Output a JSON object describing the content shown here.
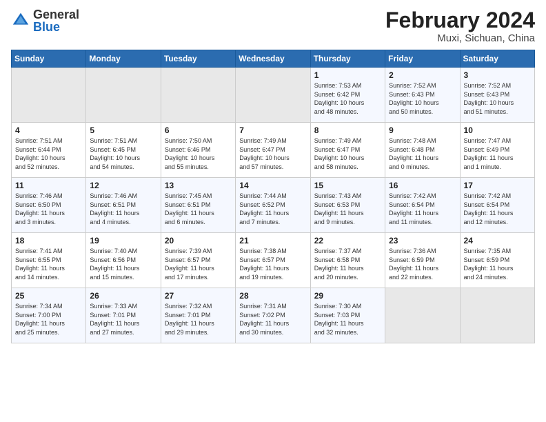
{
  "header": {
    "logo_general": "General",
    "logo_blue": "Blue",
    "month_year": "February 2024",
    "location": "Muxi, Sichuan, China"
  },
  "weekdays": [
    "Sunday",
    "Monday",
    "Tuesday",
    "Wednesday",
    "Thursday",
    "Friday",
    "Saturday"
  ],
  "weeks": [
    [
      {
        "day": "",
        "info": "",
        "empty": true
      },
      {
        "day": "",
        "info": "",
        "empty": true
      },
      {
        "day": "",
        "info": "",
        "empty": true
      },
      {
        "day": "",
        "info": "",
        "empty": true
      },
      {
        "day": "1",
        "info": "Sunrise: 7:53 AM\nSunset: 6:42 PM\nDaylight: 10 hours\nand 48 minutes.",
        "empty": false
      },
      {
        "day": "2",
        "info": "Sunrise: 7:52 AM\nSunset: 6:43 PM\nDaylight: 10 hours\nand 50 minutes.",
        "empty": false
      },
      {
        "day": "3",
        "info": "Sunrise: 7:52 AM\nSunset: 6:43 PM\nDaylight: 10 hours\nand 51 minutes.",
        "empty": false
      }
    ],
    [
      {
        "day": "4",
        "info": "Sunrise: 7:51 AM\nSunset: 6:44 PM\nDaylight: 10 hours\nand 52 minutes.",
        "empty": false
      },
      {
        "day": "5",
        "info": "Sunrise: 7:51 AM\nSunset: 6:45 PM\nDaylight: 10 hours\nand 54 minutes.",
        "empty": false
      },
      {
        "day": "6",
        "info": "Sunrise: 7:50 AM\nSunset: 6:46 PM\nDaylight: 10 hours\nand 55 minutes.",
        "empty": false
      },
      {
        "day": "7",
        "info": "Sunrise: 7:49 AM\nSunset: 6:47 PM\nDaylight: 10 hours\nand 57 minutes.",
        "empty": false
      },
      {
        "day": "8",
        "info": "Sunrise: 7:49 AM\nSunset: 6:47 PM\nDaylight: 10 hours\nand 58 minutes.",
        "empty": false
      },
      {
        "day": "9",
        "info": "Sunrise: 7:48 AM\nSunset: 6:48 PM\nDaylight: 11 hours\nand 0 minutes.",
        "empty": false
      },
      {
        "day": "10",
        "info": "Sunrise: 7:47 AM\nSunset: 6:49 PM\nDaylight: 11 hours\nand 1 minute.",
        "empty": false
      }
    ],
    [
      {
        "day": "11",
        "info": "Sunrise: 7:46 AM\nSunset: 6:50 PM\nDaylight: 11 hours\nand 3 minutes.",
        "empty": false
      },
      {
        "day": "12",
        "info": "Sunrise: 7:46 AM\nSunset: 6:51 PM\nDaylight: 11 hours\nand 4 minutes.",
        "empty": false
      },
      {
        "day": "13",
        "info": "Sunrise: 7:45 AM\nSunset: 6:51 PM\nDaylight: 11 hours\nand 6 minutes.",
        "empty": false
      },
      {
        "day": "14",
        "info": "Sunrise: 7:44 AM\nSunset: 6:52 PM\nDaylight: 11 hours\nand 7 minutes.",
        "empty": false
      },
      {
        "day": "15",
        "info": "Sunrise: 7:43 AM\nSunset: 6:53 PM\nDaylight: 11 hours\nand 9 minutes.",
        "empty": false
      },
      {
        "day": "16",
        "info": "Sunrise: 7:42 AM\nSunset: 6:54 PM\nDaylight: 11 hours\nand 11 minutes.",
        "empty": false
      },
      {
        "day": "17",
        "info": "Sunrise: 7:42 AM\nSunset: 6:54 PM\nDaylight: 11 hours\nand 12 minutes.",
        "empty": false
      }
    ],
    [
      {
        "day": "18",
        "info": "Sunrise: 7:41 AM\nSunset: 6:55 PM\nDaylight: 11 hours\nand 14 minutes.",
        "empty": false
      },
      {
        "day": "19",
        "info": "Sunrise: 7:40 AM\nSunset: 6:56 PM\nDaylight: 11 hours\nand 15 minutes.",
        "empty": false
      },
      {
        "day": "20",
        "info": "Sunrise: 7:39 AM\nSunset: 6:57 PM\nDaylight: 11 hours\nand 17 minutes.",
        "empty": false
      },
      {
        "day": "21",
        "info": "Sunrise: 7:38 AM\nSunset: 6:57 PM\nDaylight: 11 hours\nand 19 minutes.",
        "empty": false
      },
      {
        "day": "22",
        "info": "Sunrise: 7:37 AM\nSunset: 6:58 PM\nDaylight: 11 hours\nand 20 minutes.",
        "empty": false
      },
      {
        "day": "23",
        "info": "Sunrise: 7:36 AM\nSunset: 6:59 PM\nDaylight: 11 hours\nand 22 minutes.",
        "empty": false
      },
      {
        "day": "24",
        "info": "Sunrise: 7:35 AM\nSunset: 6:59 PM\nDaylight: 11 hours\nand 24 minutes.",
        "empty": false
      }
    ],
    [
      {
        "day": "25",
        "info": "Sunrise: 7:34 AM\nSunset: 7:00 PM\nDaylight: 11 hours\nand 25 minutes.",
        "empty": false
      },
      {
        "day": "26",
        "info": "Sunrise: 7:33 AM\nSunset: 7:01 PM\nDaylight: 11 hours\nand 27 minutes.",
        "empty": false
      },
      {
        "day": "27",
        "info": "Sunrise: 7:32 AM\nSunset: 7:01 PM\nDaylight: 11 hours\nand 29 minutes.",
        "empty": false
      },
      {
        "day": "28",
        "info": "Sunrise: 7:31 AM\nSunset: 7:02 PM\nDaylight: 11 hours\nand 30 minutes.",
        "empty": false
      },
      {
        "day": "29",
        "info": "Sunrise: 7:30 AM\nSunset: 7:03 PM\nDaylight: 11 hours\nand 32 minutes.",
        "empty": false
      },
      {
        "day": "",
        "info": "",
        "empty": true
      },
      {
        "day": "",
        "info": "",
        "empty": true
      }
    ]
  ]
}
